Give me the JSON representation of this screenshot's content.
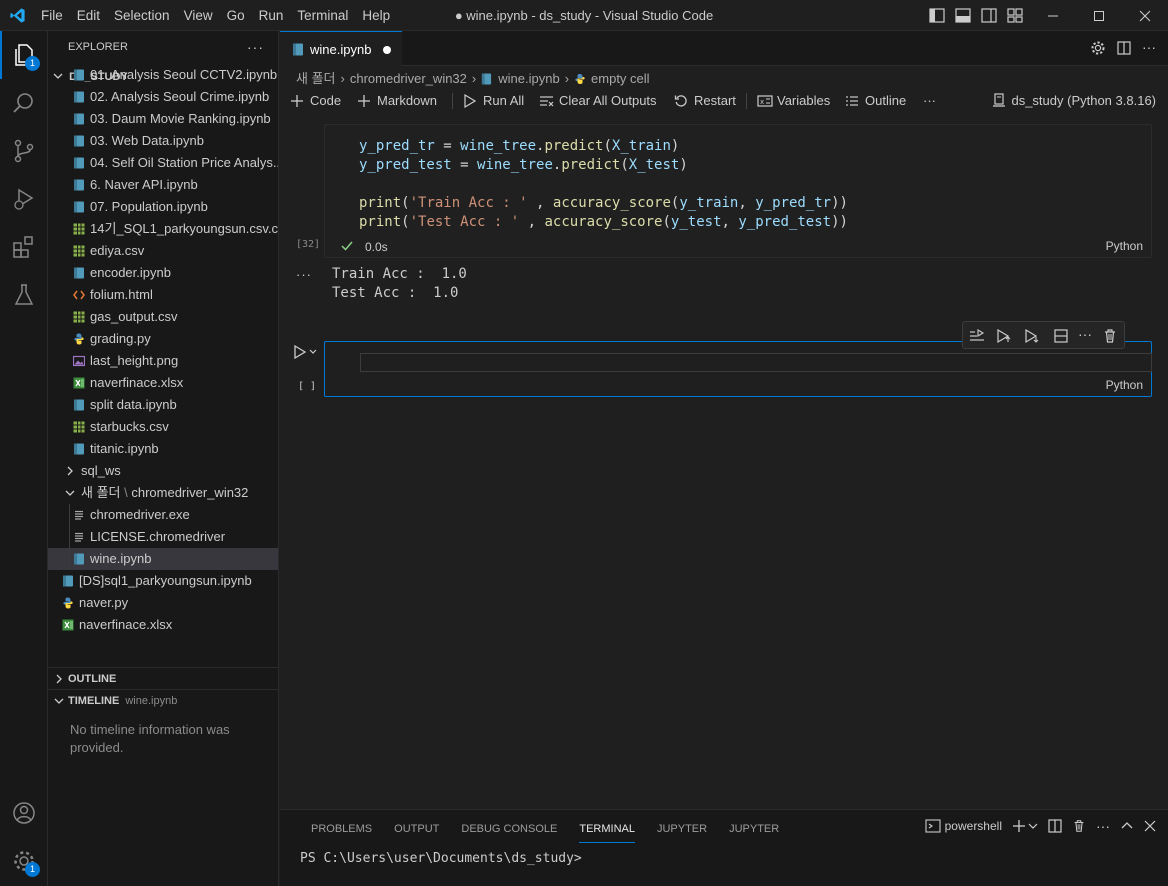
{
  "titlebar": {
    "menu": [
      "File",
      "Edit",
      "Selection",
      "View",
      "Go",
      "Run",
      "Terminal",
      "Help"
    ],
    "title": "● wine.ipynb - ds_study - Visual Studio Code"
  },
  "activitybar": {
    "explorer_badge": "1",
    "settings_badge": "1"
  },
  "sidebar": {
    "header": "EXPLORER",
    "more": "···",
    "workspace": "DS_STUDY",
    "files": [
      {
        "label": "01. Analysis Seoul CCTV2.ipynb",
        "icon": "notebook"
      },
      {
        "label": "02. Analysis Seoul Crime.ipynb",
        "icon": "notebook"
      },
      {
        "label": "03. Daum Movie Ranking.ipynb",
        "icon": "notebook"
      },
      {
        "label": "03. Web Data.ipynb",
        "icon": "notebook"
      },
      {
        "label": "04. Self Oil Station Price Analys...",
        "icon": "notebook"
      },
      {
        "label": "6. Naver API.ipynb",
        "icon": "notebook"
      },
      {
        "label": "07. Population.ipynb",
        "icon": "notebook"
      },
      {
        "label": "14기_SQL1_parkyoungsun.csv.c...",
        "icon": "csv"
      },
      {
        "label": "ediya.csv",
        "icon": "csv"
      },
      {
        "label": "encoder.ipynb",
        "icon": "notebook"
      },
      {
        "label": "folium.html",
        "icon": "html"
      },
      {
        "label": "gas_output.csv",
        "icon": "csv"
      },
      {
        "label": "grading.py",
        "icon": "python"
      },
      {
        "label": "last_height.png",
        "icon": "image"
      },
      {
        "label": "naverfinace.xlsx",
        "icon": "excel"
      },
      {
        "label": "split data.ipynb",
        "icon": "notebook"
      },
      {
        "label": "starbucks.csv",
        "icon": "csv"
      },
      {
        "label": "titanic.ipynb",
        "icon": "notebook"
      }
    ],
    "folder_sql": "sql_ws",
    "folder_new": "새 폴더",
    "folder_new_sub": "chromedriver_win32",
    "subfiles": [
      {
        "label": "chromedriver.exe",
        "icon": "lines"
      },
      {
        "label": "LICENSE.chromedriver",
        "icon": "lines"
      },
      {
        "label": "wine.ipynb",
        "icon": "notebook"
      }
    ],
    "root_files": [
      {
        "label": "[DS]sql1_parkyoungsun.ipynb",
        "icon": "notebook"
      },
      {
        "label": "naver.py",
        "icon": "python"
      },
      {
        "label": "naverfinace.xlsx",
        "icon": "excel"
      }
    ],
    "outline": "OUTLINE",
    "timeline": "TIMELINE",
    "timeline_file": "wine.ipynb",
    "timeline_msg": "No timeline information was provided."
  },
  "editor": {
    "tab_label": "wine.ipynb",
    "breadcrumb": [
      "새 폴더",
      "chromedriver_win32",
      "wine.ipynb",
      "empty cell"
    ],
    "toolbar": {
      "code": "Code",
      "markdown": "Markdown",
      "run_all": "Run All",
      "clear_outputs": "Clear All Outputs",
      "restart": "Restart",
      "variables": "Variables",
      "outline": "Outline",
      "more": "···",
      "kernel": "ds_study (Python 3.8.16)"
    },
    "cell1": {
      "exec_count": "[32]",
      "time": "0.0s",
      "lang": "Python",
      "output": [
        "Train Acc :  1.0",
        "Test Acc :  1.0"
      ],
      "output_more": "···"
    },
    "cell2": {
      "exec_count": "[ ]",
      "lang": "Python"
    }
  },
  "panel": {
    "tabs": [
      "PROBLEMS",
      "OUTPUT",
      "DEBUG CONSOLE",
      "TERMINAL",
      "JUPYTER",
      "JUPYTER"
    ],
    "active_tab": "TERMINAL",
    "shell": "powershell",
    "prompt": "PS C:\\Users\\user\\Documents\\ds_study>"
  },
  "colors": {
    "accent": "#0078d4",
    "background": "#1f1f1f",
    "sidebar": "#181818"
  }
}
